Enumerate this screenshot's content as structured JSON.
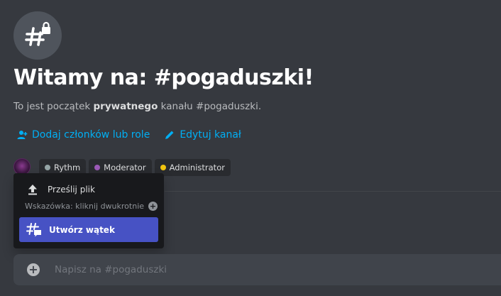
{
  "channel": {
    "title": "Witamy na: #pogaduszki!",
    "subtitle_before": "To jest początek ",
    "subtitle_bold": "prywatnego",
    "subtitle_after": " kanału #pogaduszki.",
    "icon": "private-channel-hash-lock-icon"
  },
  "actions": {
    "add_members": "Dodaj członków lub role",
    "edit_channel": "Edytuj kanał",
    "color": "#00aff4"
  },
  "roles": [
    {
      "name": "Rythm",
      "color": "#95a5a6"
    },
    {
      "name": "Moderator",
      "color": "#9b59b6"
    },
    {
      "name": "Administrator",
      "color": "#f1c40f"
    }
  ],
  "popup": {
    "upload_label": "Prześlij plik",
    "hint": "Wskazówka: kliknij dwukrotnie",
    "create_thread_label": "Utwórz wątek",
    "highlight_color": "#4752c4"
  },
  "composer": {
    "placeholder": "Napisz na #pogaduszki"
  }
}
